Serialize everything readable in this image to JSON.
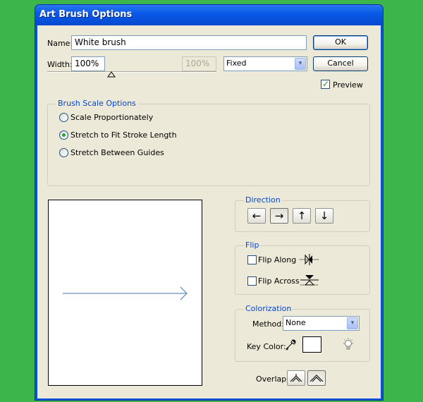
{
  "window": {
    "title": "Art Brush Options"
  },
  "name_field": {
    "label": "Name:",
    "value": "White brush"
  },
  "width_field": {
    "label": "Width:",
    "value": "100%",
    "secondary_value": "100%",
    "slider_level": 0.38
  },
  "width_mode": {
    "selected": "Fixed"
  },
  "buttons": {
    "ok": "OK",
    "cancel": "Cancel"
  },
  "preview": {
    "label": "Preview",
    "checked": true
  },
  "brush_scale": {
    "legend": "Brush Scale Options",
    "options": [
      {
        "label": "Scale Proportionately",
        "selected": false
      },
      {
        "label": "Stretch to Fit Stroke Length",
        "selected": true
      },
      {
        "label": "Stretch Between Guides",
        "selected": false
      }
    ]
  },
  "direction": {
    "legend": "Direction",
    "buttons": [
      {
        "glyph": "←",
        "name": "left",
        "active": false
      },
      {
        "glyph": "→",
        "name": "right",
        "active": true
      },
      {
        "glyph": "↑",
        "name": "up",
        "active": false
      },
      {
        "glyph": "↓",
        "name": "down",
        "active": false
      }
    ]
  },
  "flip": {
    "legend": "Flip",
    "along": {
      "label": "Flip Along",
      "checked": false
    },
    "across": {
      "label": "Flip Across",
      "checked": false
    }
  },
  "colorization": {
    "legend": "Colorization",
    "method_label": "Method:",
    "method_value": "None",
    "key_color_label": "Key Color:",
    "key_color": "#ffffff"
  },
  "overlap": {
    "label": "Overlap:"
  },
  "icons": {
    "dropdown": "▾",
    "eyedropper": "eyedropper-icon",
    "tip": "lightbulb-icon"
  },
  "colors": {
    "background": "#3cb54a",
    "title_bar": "#0a5ae8",
    "dialog_face": "#ece9d8",
    "group_legend": "#0046d5",
    "stroke_preview": "#4a76b8"
  }
}
